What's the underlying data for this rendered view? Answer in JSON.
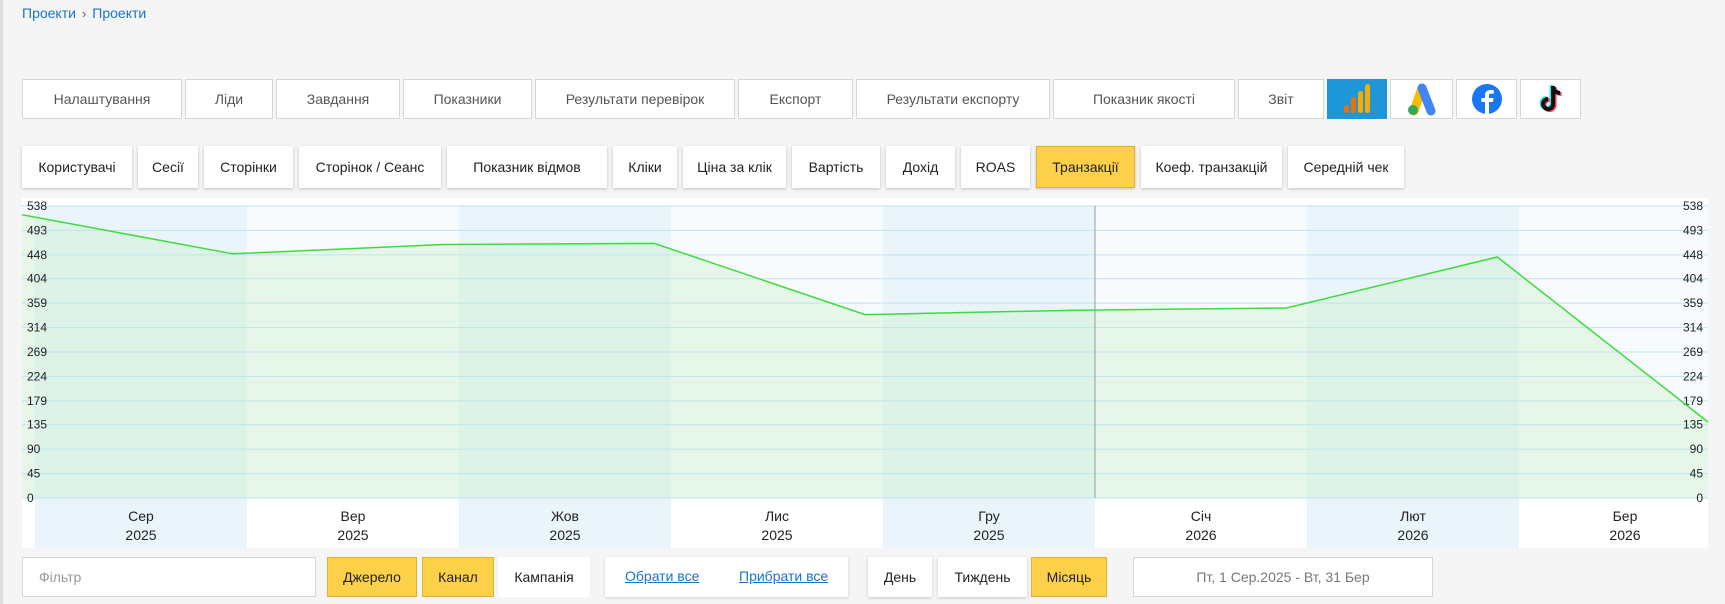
{
  "breadcrumb": {
    "items": [
      "Проекти",
      "Проекти"
    ]
  },
  "top_tabs": [
    {
      "label": "Налаштування"
    },
    {
      "label": "Ліди"
    },
    {
      "label": "Завдання"
    },
    {
      "label": "Показники"
    },
    {
      "label": "Результати перевірок"
    },
    {
      "label": "Експорт"
    },
    {
      "label": "Результати експорту"
    },
    {
      "label": "Показник якості"
    },
    {
      "label": "Звіт"
    }
  ],
  "top_icons": [
    "google-analytics-icon",
    "google-ads-icon",
    "facebook-icon",
    "tiktok-icon"
  ],
  "metric_tabs": [
    {
      "label": "Користувачі"
    },
    {
      "label": "Сесії"
    },
    {
      "label": "Сторінки"
    },
    {
      "label": "Сторінок / Сеанс"
    },
    {
      "label": "Показник відмов"
    },
    {
      "label": "Кліки"
    },
    {
      "label": "Ціна за клік"
    },
    {
      "label": "Вартість"
    },
    {
      "label": "Дохід"
    },
    {
      "label": "ROAS"
    },
    {
      "label": "Транзакції",
      "active": true
    },
    {
      "label": "Коеф. транзакцій"
    },
    {
      "label": "Середній чек"
    }
  ],
  "chart_data": {
    "type": "line",
    "title": "",
    "xlabel": "",
    "ylabel": "",
    "x": [
      {
        "month": "Сер",
        "year": "2025"
      },
      {
        "month": "Вер",
        "year": "2025"
      },
      {
        "month": "Жов",
        "year": "2025"
      },
      {
        "month": "Лис",
        "year": "2025"
      },
      {
        "month": "Гру",
        "year": "2025"
      },
      {
        "month": "Січ",
        "year": "2026"
      },
      {
        "month": "Лют",
        "year": "2026"
      },
      {
        "month": "Бер",
        "year": "2026"
      }
    ],
    "series": [
      {
        "values": [
          522,
          450,
          467,
          469,
          338,
          346,
          350,
          444,
          140
        ],
        "color": "#3ddc3d"
      }
    ],
    "y_ticks": [
      "538",
      "493",
      "448",
      "404",
      "359",
      "314",
      "269",
      "224",
      "179",
      "135",
      "90",
      "45",
      "0"
    ],
    "ylim": [
      0,
      538
    ],
    "grid": true
  },
  "filter": {
    "placeholder": "Фільтр"
  },
  "group_buttons": [
    {
      "label": "Джерело",
      "active": true
    },
    {
      "label": "Канал",
      "active": true
    },
    {
      "label": "Кампанія",
      "active": false
    }
  ],
  "links": {
    "select_all": "Обрати все",
    "clear_all": "Прибрати все"
  },
  "period_buttons": [
    {
      "label": "День",
      "active": false
    },
    {
      "label": "Тиждень",
      "active": false
    },
    {
      "label": "Місяць",
      "active": true
    }
  ],
  "date_range": "Пт, 1 Сер.2025 - Вт, 31 Бер",
  "colors": {
    "accent": "#fdd04a",
    "link": "#1a73c7",
    "line": "#3ddc3d",
    "ga_bg": "#1e96d7"
  }
}
